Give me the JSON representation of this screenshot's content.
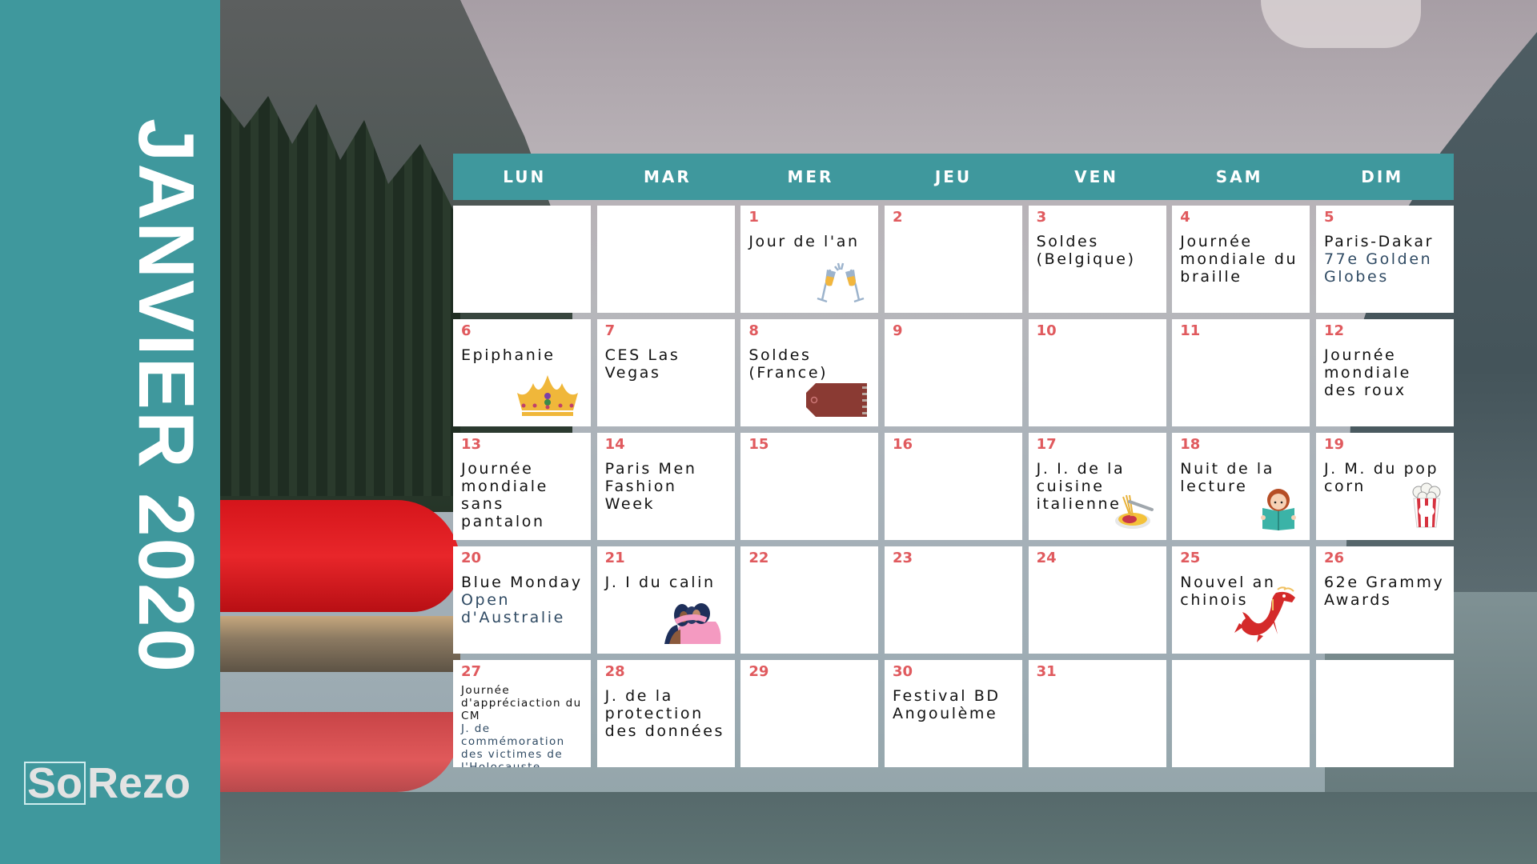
{
  "sidebar": {
    "title": "JANVIER 2020",
    "logo": {
      "part1": "So",
      "part2": "Rezo"
    }
  },
  "colors": {
    "accent": "#3f989d",
    "date_number": "#e05a5e",
    "event_text": "#111111",
    "event_alt_text": "#2f4a63",
    "cell_bg": "#ffffff"
  },
  "calendar": {
    "weekdays": [
      "LUN",
      "MAR",
      "MER",
      "JEU",
      "VEN",
      "SAM",
      "DIM"
    ],
    "weeks": [
      [
        {
          "day": "",
          "events": []
        },
        {
          "day": "",
          "events": []
        },
        {
          "day": "1",
          "events": [
            {
              "text": "Jour de l'an"
            }
          ],
          "icon": "champagne-glasses-icon"
        },
        {
          "day": "2",
          "events": []
        },
        {
          "day": "3",
          "events": [
            {
              "text": "Soldes (Belgique)"
            }
          ]
        },
        {
          "day": "4",
          "events": [
            {
              "text": "Journée mondiale du braille"
            }
          ]
        },
        {
          "day": "5",
          "events": [
            {
              "text": "Paris-Dakar"
            },
            {
              "text": "77e Golden Globes",
              "alt": true
            }
          ]
        }
      ],
      [
        {
          "day": "6",
          "events": [
            {
              "text": "Epiphanie"
            }
          ],
          "icon": "crown-icon"
        },
        {
          "day": "7",
          "events": [
            {
              "text": "CES Las Vegas"
            }
          ]
        },
        {
          "day": "8",
          "events": [
            {
              "text": "Soldes (France)"
            }
          ],
          "icon": "price-tag-icon"
        },
        {
          "day": "9",
          "events": []
        },
        {
          "day": "10",
          "events": []
        },
        {
          "day": "11",
          "events": []
        },
        {
          "day": "12",
          "events": [
            {
              "text": "Journée mondiale des roux"
            }
          ]
        }
      ],
      [
        {
          "day": "13",
          "events": [
            {
              "text": "Journée mondiale sans pantalon"
            }
          ]
        },
        {
          "day": "14",
          "events": [
            {
              "text": "Paris Men Fashion Week"
            }
          ]
        },
        {
          "day": "15",
          "events": []
        },
        {
          "day": "16",
          "events": []
        },
        {
          "day": "17",
          "events": [
            {
              "text": "J. I. de la cuisine italienne"
            }
          ],
          "icon": "pasta-plate-icon"
        },
        {
          "day": "18",
          "events": [
            {
              "text": "Nuit de la lecture"
            }
          ],
          "icon": "girl-reading-book-icon"
        },
        {
          "day": "19",
          "events": [
            {
              "text": "J. M. du pop corn"
            }
          ],
          "icon": "popcorn-icon"
        }
      ],
      [
        {
          "day": "20",
          "events": [
            {
              "text": "Blue Monday"
            },
            {
              "text": "Open d'Australie",
              "alt": true
            }
          ]
        },
        {
          "day": "21",
          "events": [
            {
              "text": "J. I du calin"
            }
          ],
          "icon": "hugging-friends-icon"
        },
        {
          "day": "22",
          "events": []
        },
        {
          "day": "23",
          "events": []
        },
        {
          "day": "24",
          "events": []
        },
        {
          "day": "25",
          "events": [
            {
              "text": "Nouvel an chinois"
            }
          ],
          "icon": "chinese-dragon-icon"
        },
        {
          "day": "26",
          "events": [
            {
              "text": "62e Grammy Awards"
            }
          ]
        }
      ],
      [
        {
          "day": "27",
          "events": [
            {
              "text": "Journée d'appréciaction du CM",
              "small": true
            },
            {
              "text": "J. de commémoration des victimes de l'Holocauste",
              "small": true,
              "alt": true
            }
          ]
        },
        {
          "day": "28",
          "events": [
            {
              "text": "J. de la protection des données"
            }
          ]
        },
        {
          "day": "29",
          "events": []
        },
        {
          "day": "30",
          "events": [
            {
              "text": "Festival BD Angoulème"
            }
          ]
        },
        {
          "day": "31",
          "events": []
        },
        {
          "day": "",
          "events": []
        },
        {
          "day": "",
          "events": []
        }
      ]
    ]
  }
}
